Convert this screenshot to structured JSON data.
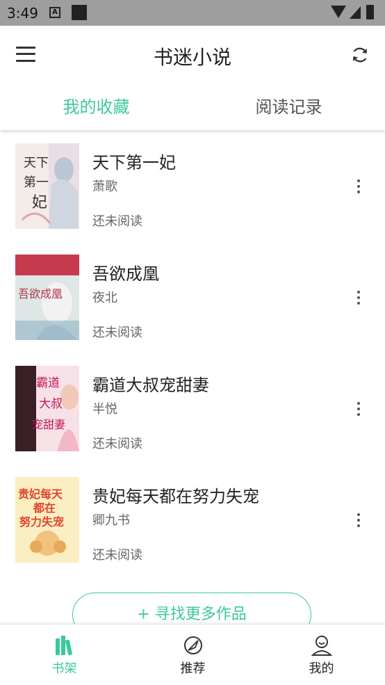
{
  "status_bar": {
    "time": "3:49",
    "notification_letter": "A"
  },
  "app_bar": {
    "title": "书迷小说"
  },
  "tabs": [
    {
      "label": "我的收藏",
      "active": true
    },
    {
      "label": "阅读记录",
      "active": false
    }
  ],
  "books": [
    {
      "title": "天下第一妃",
      "author": "萧歌",
      "status": "还未阅读",
      "cover_text": [
        "天下",
        "第一",
        "妃"
      ]
    },
    {
      "title": "吾欲成凰",
      "author": "夜北",
      "status": "还未阅读",
      "cover_text": [
        "吾欲成凰"
      ]
    },
    {
      "title": "霸道大叔宠甜妻",
      "author": "半悦",
      "status": "还未阅读",
      "cover_text": [
        "霸道",
        "大叔",
        "宠甜妻"
      ]
    },
    {
      "title": "贵妃每天都在努力失宠",
      "author": "卿九书",
      "status": "还未阅读",
      "cover_text": [
        "贵妃每天",
        "都在",
        "努力失宠"
      ]
    }
  ],
  "find_more_label": "+ 寻找更多作品",
  "bottom_nav": [
    {
      "label": "书架",
      "active": true
    },
    {
      "label": "推荐",
      "active": false
    },
    {
      "label": "我的",
      "active": false
    }
  ],
  "colors": {
    "accent": "#3cc99a",
    "status_bar": "#9e9e9e",
    "text_primary": "#222222",
    "text_secondary": "#666666"
  }
}
